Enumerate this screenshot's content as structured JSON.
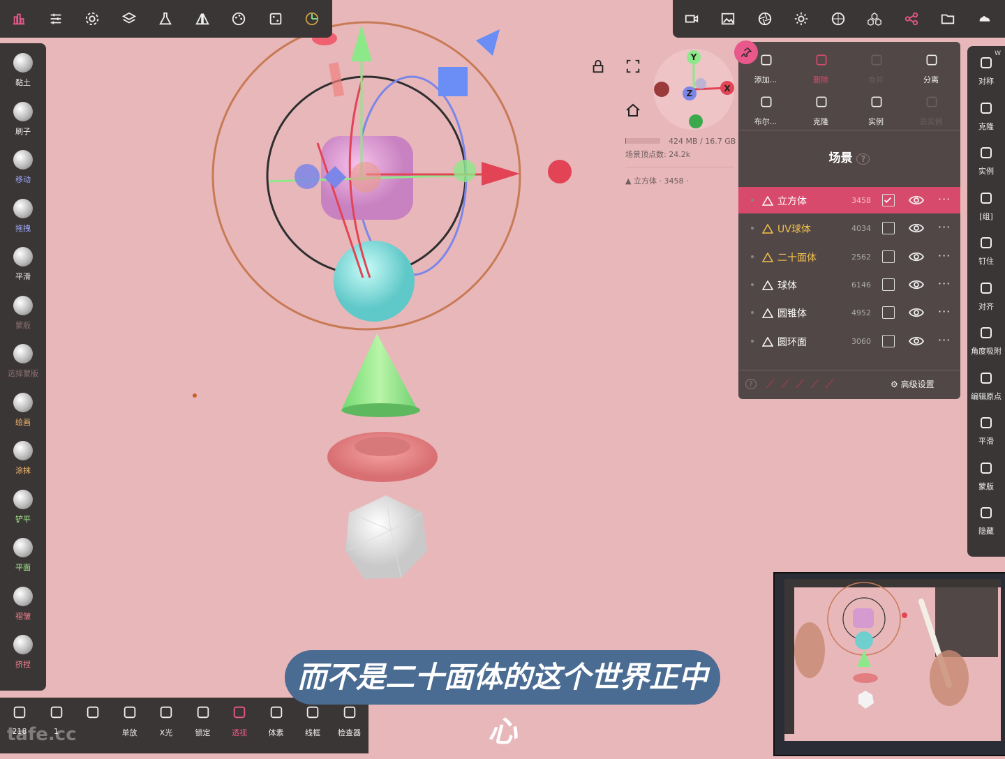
{
  "left_tools": [
    {
      "label": "黏土",
      "color": "#eeeeee"
    },
    {
      "label": "刷子",
      "color": "#eeeeee"
    },
    {
      "label": "移动",
      "color": "#9da6f7"
    },
    {
      "label": "拖拽",
      "color": "#9da6f7"
    },
    {
      "label": "平滑",
      "color": "#eeeeee"
    },
    {
      "label": "蒙版",
      "color": "#8a6f72"
    },
    {
      "label": "选择蒙版",
      "color": "#8a6f72"
    },
    {
      "label": "绘画",
      "color": "#f3b96a"
    },
    {
      "label": "涂抹",
      "color": "#f3b96a"
    },
    {
      "label": "铲平",
      "color": "#a7f08d"
    },
    {
      "label": "平面",
      "color": "#a7f08d"
    },
    {
      "label": "褶皱",
      "color": "#f07f8c"
    },
    {
      "label": "挤捏",
      "color": "#f07f8c"
    }
  ],
  "right_tools": [
    {
      "label": "对称",
      "icon": "symmetry-icon"
    },
    {
      "label": "克隆",
      "icon": "clone-icon"
    },
    {
      "label": "实例",
      "icon": "link-icon"
    },
    {
      "label": "[组]",
      "icon": "group-icon"
    },
    {
      "label": "钉住",
      "icon": "pin-icon"
    },
    {
      "label": "对齐",
      "icon": "align-icon"
    },
    {
      "label": "角度吸附",
      "icon": "angle-snap-icon"
    },
    {
      "label": "编辑原点",
      "icon": "lock-icon"
    },
    {
      "label": "平滑",
      "icon": "smooth-icon"
    },
    {
      "label": "蒙版",
      "icon": "mask-icon"
    },
    {
      "label": "隐藏",
      "icon": "hide-icon"
    }
  ],
  "right_corner_label": "W",
  "bottom_tools": [
    {
      "label": "",
      "sub": "218"
    },
    {
      "label": "",
      "sub": "1"
    },
    {
      "label": ""
    },
    {
      "label": "单放"
    },
    {
      "label": "X光"
    },
    {
      "label": "锁定"
    },
    {
      "label": "透视",
      "active": true
    },
    {
      "label": "体素"
    },
    {
      "label": "线框"
    },
    {
      "label": "检查器"
    }
  ],
  "panel": {
    "buttons": [
      {
        "label": "添加...",
        "icon": "plus-icon"
      },
      {
        "label": "删除",
        "icon": "trash-icon",
        "color": "#d84a6b"
      },
      {
        "label": "合并",
        "icon": "merge-icon",
        "color": "#6d5d5e"
      },
      {
        "label": "分离",
        "icon": "split-icon"
      },
      {
        "label": "布尔...",
        "icon": "boolean-icon"
      },
      {
        "label": "克隆",
        "icon": "clone-icon"
      },
      {
        "label": "实例",
        "icon": "link-icon"
      },
      {
        "label": "去实例",
        "icon": "unlink-icon",
        "color": "#6d5d5e"
      }
    ],
    "scene_title": "场景",
    "rows": [
      {
        "name": "立方体",
        "count": "3458",
        "selected": true,
        "checked": true,
        "color": "#ffffff"
      },
      {
        "name": "UV球体",
        "count": "4034",
        "color": "#f3c14c"
      },
      {
        "name": "二十面体",
        "count": "2562",
        "color": "#f3c14c"
      },
      {
        "name": "球体",
        "count": "6146",
        "color": "#ffffff"
      },
      {
        "name": "圆锥体",
        "count": "4952",
        "color": "#ffffff"
      },
      {
        "name": "圆环面",
        "count": "3060",
        "color": "#ffffff"
      }
    ],
    "advanced": "高级设置"
  },
  "stats": {
    "memory": "424 MB / 16.7 GB",
    "vertices": "场景顶点数: 24.2k",
    "selected": "立方体 · 3458 ·",
    "memory_fraction": 0.02
  },
  "gizmo_axes": {
    "x": "X",
    "y": "Y",
    "z": "Z"
  },
  "subtitle": "而不是二十面体的这个世界正中心",
  "watermark": "tafe.cc"
}
